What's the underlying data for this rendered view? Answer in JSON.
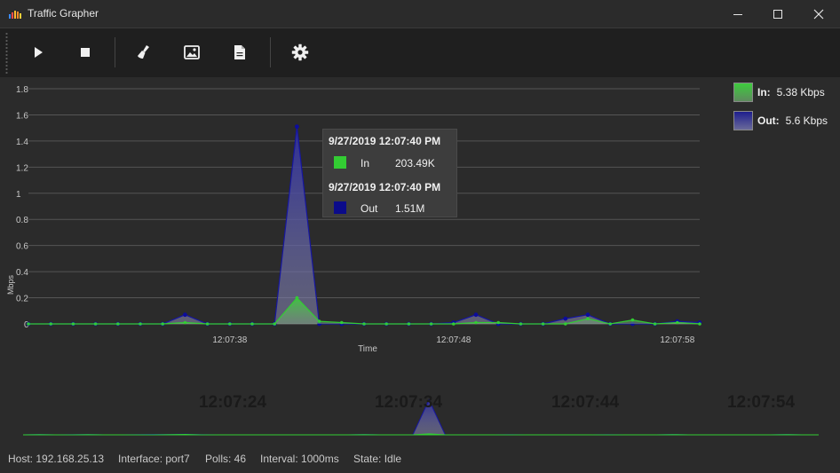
{
  "window": {
    "title": "Traffic Grapher"
  },
  "toolbar": {
    "items": [
      "play-icon",
      "stop-icon",
      "clear-icon",
      "image-icon",
      "document-icon",
      "gear-icon"
    ]
  },
  "legend": {
    "in": {
      "label": "In:",
      "value": "5.38 Kbps",
      "color": "#3dbb3d"
    },
    "out": {
      "label": "Out:",
      "value": "5.6 Kbps",
      "color": "#1a1a8e"
    }
  },
  "tooltip": {
    "in_time": "9/27/2019 12:07:40 PM",
    "in_name": "In",
    "in_value": "203.49K",
    "out_time": "9/27/2019 12:07:40 PM",
    "out_name": "Out",
    "out_value": "1.51M"
  },
  "chart_data": {
    "type": "area",
    "title": "",
    "xlabel": "Time",
    "ylabel": "Mbps",
    "ylim": [
      0,
      1.8
    ],
    "yticks": [
      "0",
      "0.2",
      "0.4",
      "0.6",
      "0.8",
      "1",
      "1.2",
      "1.4",
      "1.6",
      "1.8"
    ],
    "xticks": [
      "12:07:38",
      "12:07:48",
      "12:07:58"
    ],
    "grid": true,
    "legend_position": "top-right",
    "series": [
      {
        "name": "In",
        "color": "#3dbb3d",
        "values": [
          0,
          0,
          0,
          0,
          0,
          0,
          0,
          0.01,
          0,
          0,
          0,
          0,
          0.2,
          0.02,
          0.01,
          0,
          0,
          0,
          0,
          0,
          0.01,
          0.01,
          0,
          0,
          0,
          0.04,
          0,
          0.03,
          0,
          0.01,
          0
        ]
      },
      {
        "name": "Out",
        "color": "#1a1a8e",
        "values": [
          0,
          0,
          0,
          0,
          0,
          0,
          0,
          0.07,
          0,
          0,
          0,
          0,
          1.51,
          0,
          0,
          0,
          0,
          0,
          0,
          0.01,
          0.07,
          0,
          0,
          0,
          0.04,
          0.07,
          0,
          0,
          0,
          0.02,
          0.01
        ]
      }
    ]
  },
  "overview": {
    "labels": [
      "12:07:24",
      "12:07:34",
      "12:07:44",
      "12:07:54"
    ],
    "in_values": [
      0,
      0.01,
      0,
      0,
      0.01,
      0,
      0,
      0,
      0,
      0.01,
      0.02,
      0,
      0,
      0,
      0,
      0,
      0,
      0,
      0,
      0,
      0,
      0.01,
      0,
      0,
      0,
      0.04,
      0,
      0,
      0,
      0,
      0,
      0,
      0,
      0,
      0,
      0,
      0,
      0,
      0,
      0,
      0.01,
      0,
      0,
      0,
      0,
      0,
      0,
      0.01,
      0,
      0
    ],
    "out_values": [
      0,
      0.02,
      0,
      0.01,
      0.02,
      0,
      0,
      0.01,
      0.02,
      0.02,
      0.03,
      0.01,
      0,
      0,
      0,
      0,
      0,
      0,
      0,
      0,
      0,
      0.02,
      0,
      0,
      0,
      1.5,
      0,
      0,
      0,
      0,
      0.01,
      0,
      0,
      0,
      0,
      0,
      0.01,
      0,
      0,
      0,
      0.02,
      0,
      0,
      0,
      0,
      0,
      0,
      0.02,
      0,
      0
    ]
  },
  "status": {
    "host": "Host: 192.168.25.13",
    "interface": "Interface: port7",
    "polls": "Polls: 46",
    "interval": "Interval: 1000ms",
    "state": "State: Idle"
  }
}
